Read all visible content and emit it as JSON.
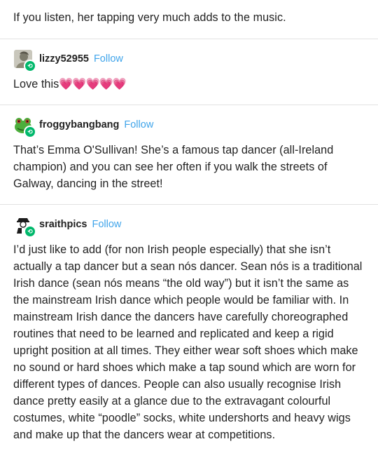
{
  "intro": {
    "text": "If you listen, her tapping very much adds to the music."
  },
  "replies": [
    {
      "username": "lizzy52955",
      "follow": "Follow",
      "body": "Love this",
      "emoji": "💗💗💗💗💗",
      "avatar_color": "#9a9a88"
    },
    {
      "username": "froggybangbang",
      "follow": "Follow",
      "body": "That’s Emma O'Sullivan! She’s a famous tap dancer (all-Ireland champion) and you can see her often if you walk the streets of Galway, dancing in the street!",
      "avatar_color": "#4cae3c"
    },
    {
      "username": "sraithpics",
      "follow": "Follow",
      "body": "I’d just like to add (for non Irish people especially) that she isn’t actually a tap dancer but a sean nós dancer. Sean nós is a traditional Irish dance (sean nós means “the old way”) but it isn’t the same as the mainstream Irish dance which people would be familiar with. In mainstream Irish dance the dancers have carefully choreographed routines that need to be learned and replicated and keep a rigid upright position at all times. They either wear soft shoes which make no sound or hard shoes which make a tap sound which are worn for different types of dances. People can also usually recognise Irish dance pretty easily at a glance due to the extravagant colourful costumes, white “poodle” socks, white undershorts and heavy wigs and make up that the dancers wear at competitions.",
      "avatar_color": "#222222"
    }
  ],
  "colors": {
    "follow": "#3fa4ea",
    "badge": "#00b86b",
    "separator": "#e2e2e2"
  }
}
